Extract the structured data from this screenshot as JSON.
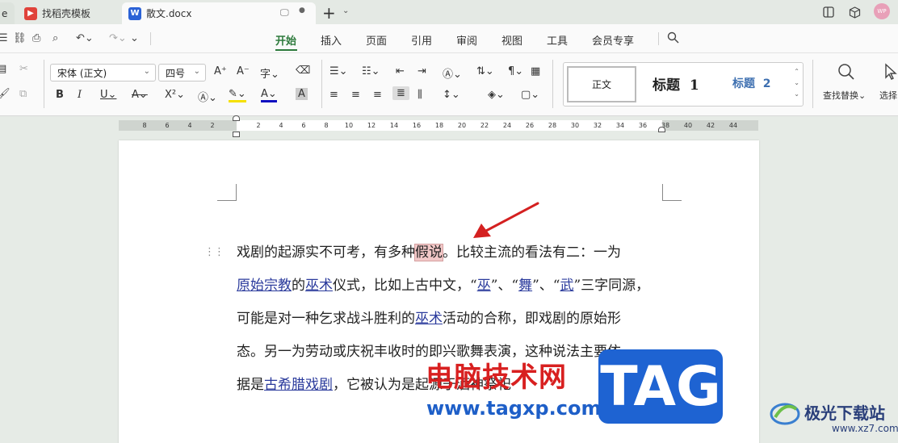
{
  "tabs": [
    {
      "label": "e"
    },
    {
      "icon": "wps-template-icon",
      "label": "找稻壳模板"
    },
    {
      "icon": "word-doc-icon",
      "icon_letter": "W",
      "label": "散文.docx"
    }
  ],
  "user_badge": "WP",
  "menu": [
    "开始",
    "插入",
    "页面",
    "引用",
    "审阅",
    "视图",
    "工具",
    "会员专享"
  ],
  "active_menu": "开始",
  "ribbon": {
    "font_name": "宋体 (正文)",
    "font_size": "四号",
    "styles": {
      "normal": "正文",
      "h1": "标题",
      "h1_num": "1",
      "h2": "标题",
      "h2_num": "2"
    },
    "find_replace": "查找替换",
    "select": "选择"
  },
  "ruler_ticks": [
    "8",
    "6",
    "4",
    "2",
    "2",
    "4",
    "6",
    "8",
    "10",
    "12",
    "14",
    "16",
    "18",
    "20",
    "22",
    "24",
    "26",
    "28",
    "30",
    "32",
    "34",
    "36",
    "38",
    "40",
    "42",
    "44"
  ],
  "document": {
    "line1_a": "戏剧的起源实不可考，有多种",
    "line1_sel": "假说",
    "line1_b": "。比较主流的看法有二：一为",
    "line2_link1": "原始宗教",
    "line2_a": "的",
    "line2_link2": "巫术",
    "line2_b": "仪式，比如上古中文，“",
    "line2_link3": "巫",
    "line2_c": "”、“",
    "line2_link4": "舞",
    "line2_d": "”、“",
    "line2_link5": "武",
    "line2_e": "”三字同源，",
    "line3_a": "可能是对一种乞求战斗胜利的",
    "line3_link": "巫术",
    "line3_b": "活动的合称，即戏剧的原始形",
    "line4": "态。另一为劳动或庆祝丰收时的即兴歌舞表演，这种说法主要依",
    "line5_a": "据是",
    "line5_link": "古希腊戏剧",
    "line5_b": "，它被认为是起源于酒神祭祀"
  },
  "watermark": {
    "cn": "电脑技术网",
    "url": "www.tagxp.com",
    "tag": "TAG",
    "site": "极光下载站",
    "site_url": "www.xz7.com"
  },
  "colors": {
    "accent": "#2d7a3c",
    "link": "#2a3a9c",
    "selection": "#f2c8c8",
    "arrow": "#d42020"
  }
}
